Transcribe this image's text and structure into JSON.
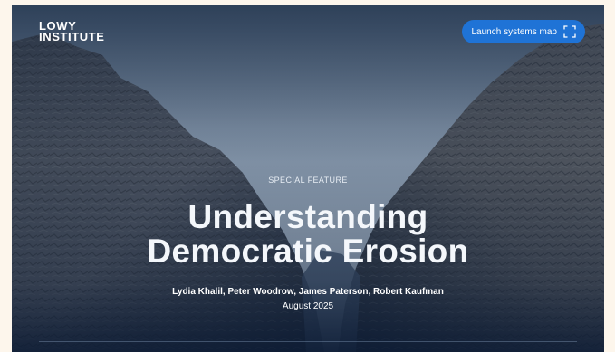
{
  "header": {
    "logo_line1": "LOWY",
    "logo_line2": "INSTITUTE",
    "launch_button_label": "Launch systems map",
    "launch_button_icon": "expand-icon",
    "accent_color": "#1f73d6"
  },
  "hero": {
    "eyebrow": "SPECIAL FEATURE",
    "title_line1": "Understanding",
    "title_line2": "Democratic Erosion",
    "authors": "Lydia Khalil, Peter Woodrow, James Paterson, Robert Kaufman",
    "date": "August 2025"
  }
}
